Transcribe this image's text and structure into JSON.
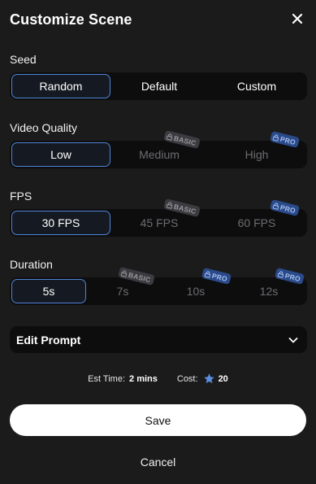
{
  "header": {
    "title": "Customize Scene"
  },
  "seed": {
    "label": "Seed",
    "options": [
      "Random",
      "Default",
      "Custom"
    ],
    "selected": "Random"
  },
  "video_quality": {
    "label": "Video Quality",
    "options": [
      "Low",
      "Medium",
      "High"
    ],
    "selected": "Low",
    "badges": {
      "Medium": "BASIC",
      "High": "PRO"
    }
  },
  "fps": {
    "label": "FPS",
    "options": [
      "30 FPS",
      "45 FPS",
      "60 FPS"
    ],
    "selected": "30 FPS",
    "badges": {
      "45 FPS": "BASIC",
      "60 FPS": "PRO"
    }
  },
  "duration": {
    "label": "Duration",
    "options": [
      "5s",
      "7s",
      "10s",
      "12s"
    ],
    "selected": "5s",
    "badges": {
      "7s": "BASIC",
      "10s": "PRO",
      "12s": "PRO"
    }
  },
  "edit_prompt": {
    "label": "Edit Prompt"
  },
  "estimate": {
    "time_label": "Est Time:",
    "time_value": "2 mins",
    "cost_label": "Cost:",
    "cost_value": "20"
  },
  "actions": {
    "save_label": "Save",
    "cancel_label": "Cancel"
  },
  "colors": {
    "accent": "#4f84d6",
    "pro_badge": "#2b4a8a",
    "basic_badge": "#3b3b40",
    "star": "#5b8fe0"
  },
  "icons": {
    "close": "close-icon",
    "chevron": "chevron-down-icon",
    "star": "star-icon",
    "lock": "lock-icon"
  }
}
